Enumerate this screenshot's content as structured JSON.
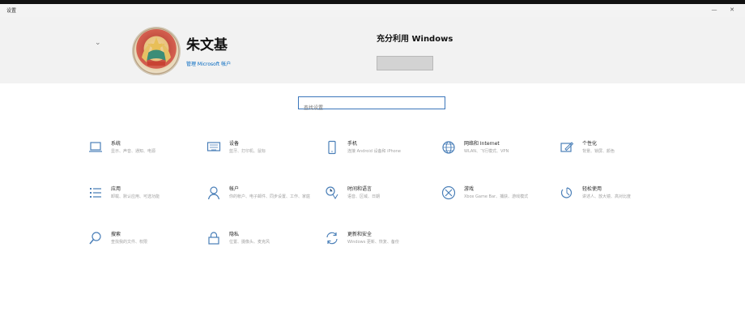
{
  "window": {
    "title": "设置",
    "minimize_glyph": "—",
    "close_glyph": "✕"
  },
  "account": {
    "name": "朱文基",
    "email": "",
    "link": "管理 Microsoft 帐户"
  },
  "promo": {
    "title": "充分利用 Windows",
    "text": "",
    "button_label": "",
    "link": ""
  },
  "search": {
    "placeholder": "查找设置"
  },
  "tiles": [
    {
      "title": "系统",
      "desc": "显示、声音、通知、电源",
      "icon": "laptop-icon"
    },
    {
      "title": "设备",
      "desc": "蓝牙、打印机、鼠标",
      "icon": "keyboard-icon"
    },
    {
      "title": "手机",
      "desc": "连接 Android 设备和 iPhone",
      "icon": "phone-icon"
    },
    {
      "title": "网络和 Internet",
      "desc": "WLAN、飞行模式、VPN",
      "icon": "globe-icon"
    },
    {
      "title": "个性化",
      "desc": "背景、锁屏、颜色",
      "icon": "pen-tablet-icon"
    },
    {
      "title": "应用",
      "desc": "卸载、默认应用、可选功能",
      "icon": "apps-list-icon"
    },
    {
      "title": "帐户",
      "desc": "你的帐户、电子邮件、同步设置、工作、家庭",
      "icon": "person-icon"
    },
    {
      "title": "时间和语言",
      "desc": "语音、区域、日期",
      "icon": "time-language-icon"
    },
    {
      "title": "游戏",
      "desc": "Xbox Game Bar、捕获、游戏模式",
      "icon": "xbox-icon"
    },
    {
      "title": "轻松使用",
      "desc": "讲述人、放大镜、高对比度",
      "icon": "accessibility-icon"
    },
    {
      "title": "搜索",
      "desc": "查找我的文件、权限",
      "icon": "search-icon"
    },
    {
      "title": "隐私",
      "desc": "位置、摄像头、麦克风",
      "icon": "lock-icon"
    },
    {
      "title": "更新和安全",
      "desc": "Windows 更新、恢复、备份",
      "icon": "update-icon"
    }
  ],
  "colors": {
    "accent": "#0067c0",
    "icon_blue": "#4a7fb8",
    "header_bg": "#f2f2f2"
  }
}
